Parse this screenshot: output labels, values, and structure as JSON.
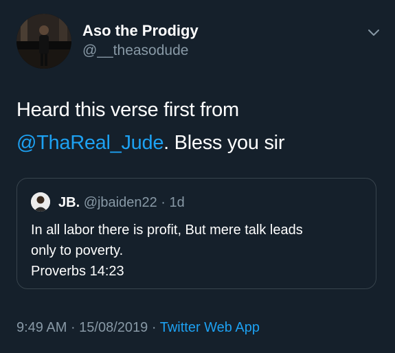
{
  "author": {
    "display_name": "Aso the Prodigy",
    "handle": "@__theasodude"
  },
  "tweet": {
    "text_line1": "Heard this verse first from",
    "mention": "@ThaReal_Jude",
    "text_line2_rest": ". Bless you sir"
  },
  "quoted_tweet": {
    "name": "JB.",
    "handle": "@jbaiden22",
    "separator": " · ",
    "age": "1d",
    "lines": [
      "In all labor there is profit, But mere talk leads",
      "only to poverty.",
      "Proverbs 14:23"
    ]
  },
  "footer": {
    "time": "9:49 AM",
    "date": "15/08/2019",
    "separator": " · ",
    "source": "Twitter Web App"
  },
  "icons": {
    "more": "chevron-down-icon"
  },
  "colors": {
    "background": "#15202b",
    "accent": "#1da1f2",
    "secondary_text": "#8899a6",
    "border": "#38444d"
  }
}
